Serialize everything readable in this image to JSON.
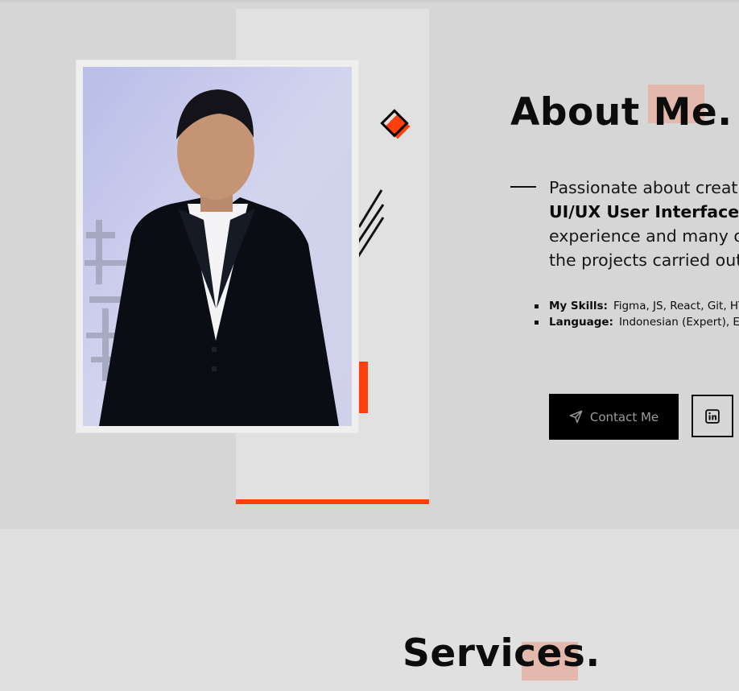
{
  "about": {
    "title": "About Me.",
    "description": {
      "line1": "Passionate about creating",
      "line2_bold": "UI/UX User Interface",
      "line3": "experience and many of",
      "line4": "the projects carried out"
    },
    "skills": [
      {
        "key": "My Skills:",
        "value": "Figma, JS, React, Git, HTML"
      },
      {
        "key": "Language:",
        "value": "Indonesian (Expert), English"
      }
    ],
    "contact_label": "Contact Me",
    "icons": {
      "contact": "send-icon",
      "linkedin": "linkedin-icon"
    }
  },
  "services": {
    "title": "Services."
  },
  "colors": {
    "accent": "#ff3f0c",
    "highlight": "#e4b9ad",
    "background": "#d6d6d6",
    "panel": "#e1e1e1",
    "button": "#000000"
  }
}
